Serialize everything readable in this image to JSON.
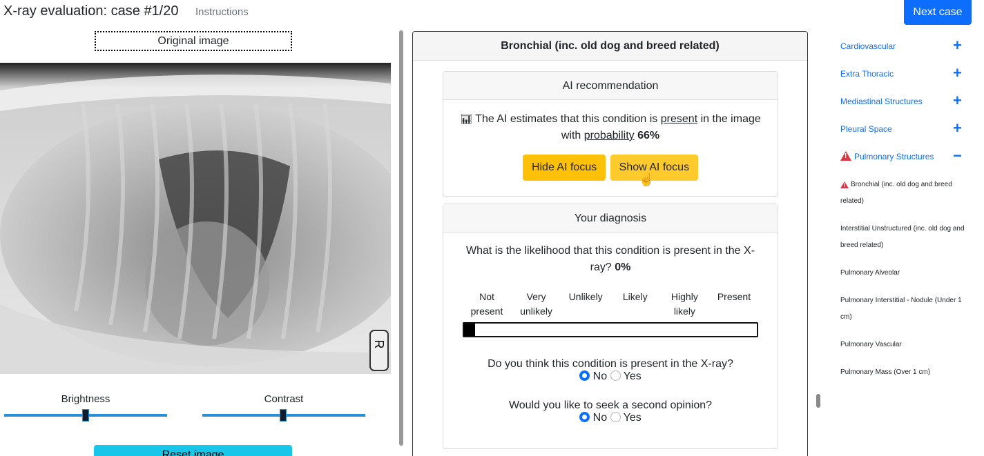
{
  "header": {
    "title": "X-ray evaluation: case #1/20",
    "instructions": "Instructions",
    "next_button": "Next case"
  },
  "image_panel": {
    "original_image_label": "Original image",
    "brightness_label": "Brightness",
    "contrast_label": "Contrast",
    "brightness_value": 0.5,
    "contrast_value": 0.5,
    "reset_button": "Reset image",
    "marker_letter": "R"
  },
  "condition": {
    "title": "Bronchial (inc. old dog and breed related)",
    "ai_card": {
      "header": "AI recommendation",
      "text_prefix": "The AI estimates that this condition is",
      "status": "present",
      "text_mid": "in the image with",
      "prob_label": "probability",
      "probability": "66%",
      "hide_button": "Hide AI focus",
      "show_button": "Show AI focus"
    },
    "diagnosis_card": {
      "header": "Your diagnosis",
      "likelihood_question": "What is the likelihood that this condition is present in the X-ray?",
      "likelihood_value": "0%",
      "scale": [
        "Not present",
        "Very unlikely",
        "Unlikely",
        "Likely",
        "Highly likely",
        "Present"
      ],
      "present_question": "Do you think this condition is present in the X-ray?",
      "second_opinion_question": "Would you like to seek a second opinion?",
      "no_label": "No",
      "yes_label": "Yes"
    }
  },
  "nav": {
    "categories": [
      "Cardiovascular",
      "Extra Thoracic",
      "Mediastinal Structures",
      "Pleural Space",
      "Pulmonary Structures"
    ],
    "subitems": [
      "Bronchial (inc. old dog and breed related)",
      "Interstitial Unstructured (inc. old dog and breed related)",
      "Pulmonary Alveolar",
      "Pulmonary Interstitial - Nodule (Under 1 cm)",
      "Pulmonary Vascular",
      "Pulmonary Mass (Over 1 cm)"
    ]
  },
  "colors": {
    "primary": "#0d6efd",
    "warning": "#ffc107",
    "danger": "#dc3545",
    "info": "#17c6e9"
  }
}
